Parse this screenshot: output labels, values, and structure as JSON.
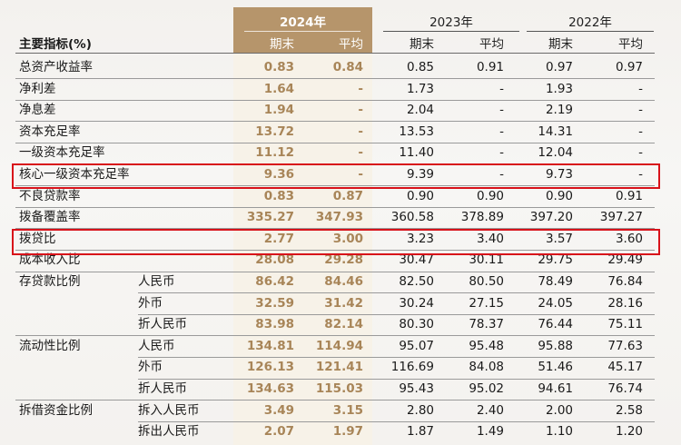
{
  "header": {
    "title": "主要指标(%)",
    "years": [
      "2024年",
      "2023年",
      "2022年"
    ],
    "sub_end": "期末",
    "sub_avg": "平均"
  },
  "rows": [
    {
      "label": "总资产收益率",
      "sub": "",
      "v": [
        "0.83",
        "0.84",
        "0.85",
        "0.91",
        "0.97",
        "0.97"
      ]
    },
    {
      "label": "净利差",
      "sub": "",
      "v": [
        "1.64",
        "-",
        "1.73",
        "-",
        "1.93",
        "-"
      ]
    },
    {
      "label": "净息差",
      "sub": "",
      "v": [
        "1.94",
        "-",
        "2.04",
        "-",
        "2.19",
        "-"
      ]
    },
    {
      "label": "资本充足率",
      "sub": "",
      "v": [
        "13.72",
        "-",
        "13.53",
        "-",
        "14.31",
        "-"
      ]
    },
    {
      "label": "一级资本充足率",
      "sub": "",
      "v": [
        "11.12",
        "-",
        "11.40",
        "-",
        "12.04",
        "-"
      ]
    },
    {
      "label": "核心一级资本充足率",
      "sub": "",
      "v": [
        "9.36",
        "-",
        "9.39",
        "-",
        "9.73",
        "-"
      ]
    },
    {
      "label": "不良贷款率",
      "sub": "",
      "v": [
        "0.83",
        "0.87",
        "0.90",
        "0.90",
        "0.90",
        "0.91"
      ]
    },
    {
      "label": "拨备覆盖率",
      "sub": "",
      "v": [
        "335.27",
        "347.93",
        "360.58",
        "378.89",
        "397.20",
        "397.27"
      ]
    },
    {
      "label": "拨贷比",
      "sub": "",
      "v": [
        "2.77",
        "3.00",
        "3.23",
        "3.40",
        "3.57",
        "3.60"
      ]
    },
    {
      "label": "成本收入比",
      "sub": "",
      "v": [
        "28.08",
        "29.28",
        "30.47",
        "30.11",
        "29.75",
        "29.49"
      ]
    },
    {
      "label": "存贷款比例",
      "sub": "人民币",
      "v": [
        "86.42",
        "84.46",
        "82.50",
        "80.50",
        "78.49",
        "76.84"
      ]
    },
    {
      "label": "",
      "sub": "外币",
      "v": [
        "32.59",
        "31.42",
        "30.24",
        "27.15",
        "24.05",
        "28.16"
      ]
    },
    {
      "label": "",
      "sub": "折人民币",
      "v": [
        "83.98",
        "82.14",
        "80.30",
        "78.37",
        "76.44",
        "75.11"
      ]
    },
    {
      "label": "流动性比例",
      "sub": "人民币",
      "v": [
        "134.81",
        "114.94",
        "95.07",
        "95.48",
        "95.88",
        "77.63"
      ]
    },
    {
      "label": "",
      "sub": "外币",
      "v": [
        "126.13",
        "121.41",
        "116.69",
        "84.08",
        "51.46",
        "45.17"
      ]
    },
    {
      "label": "",
      "sub": "折人民币",
      "v": [
        "134.63",
        "115.03",
        "95.43",
        "95.02",
        "94.61",
        "76.74"
      ]
    },
    {
      "label": "拆借资金比例",
      "sub": "拆入人民币",
      "v": [
        "3.49",
        "3.15",
        "2.80",
        "2.40",
        "2.00",
        "2.58"
      ]
    },
    {
      "label": "",
      "sub": "拆出人民币",
      "v": [
        "2.07",
        "1.97",
        "1.87",
        "1.49",
        "1.10",
        "1.20"
      ]
    }
  ],
  "colors": {
    "gold_header": "#b6956b",
    "gold_text": "#a88558",
    "highlight_box": "#d8121a"
  }
}
